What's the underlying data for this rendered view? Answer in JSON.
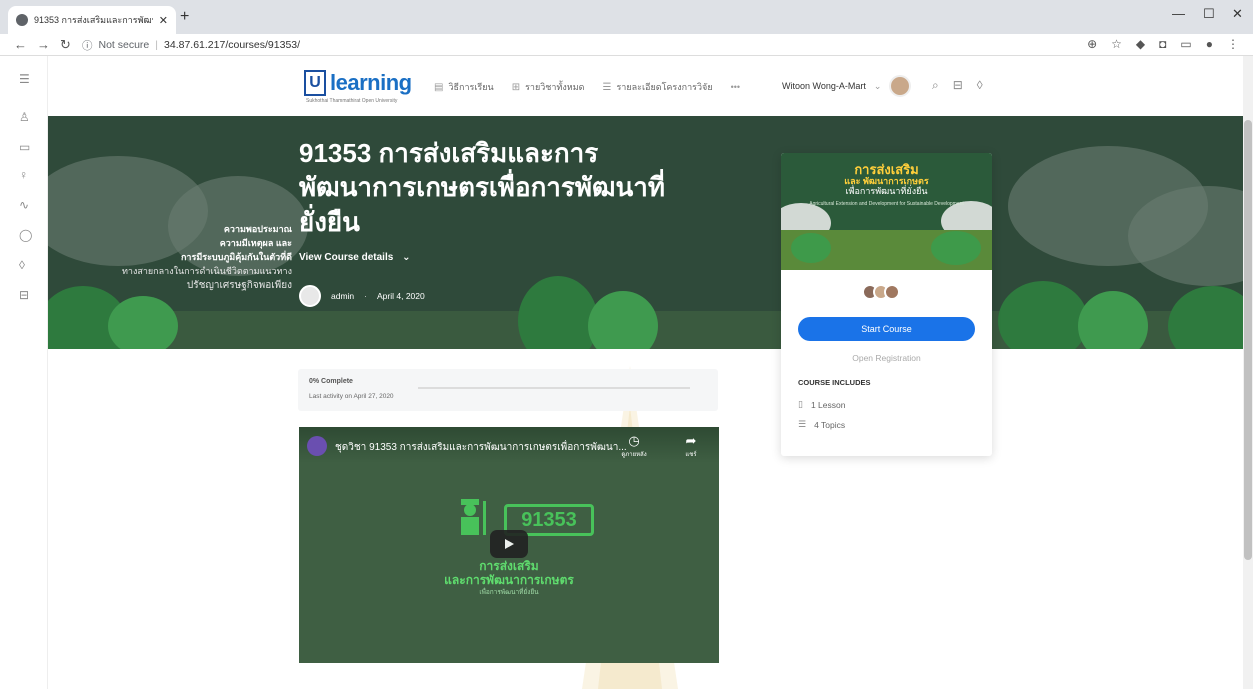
{
  "browser": {
    "tab_title": "91353 การส่งเสริมและการพัฒนาการ",
    "new_tab": "+",
    "url_secure": "Not secure",
    "url": "34.87.61.217/courses/91353/"
  },
  "header": {
    "logo_text": "learning",
    "logo_letter": "U",
    "logo_sub": "Sukhothai Thammathirat Open University",
    "nav": [
      {
        "label": "วิธีการเรียน",
        "icon": "document-icon"
      },
      {
        "label": "รายวิชาทั้งหมด",
        "icon": "grid-icon"
      },
      {
        "label": "รายละเอียดโครงการวิจัย",
        "icon": "list-icon"
      }
    ],
    "more": "•••",
    "user_name": "Witoon Wong-A-Mart",
    "user_chevron": "⌄"
  },
  "hero": {
    "title": "91353 การส่งเสริมและการพัฒนาการเกษตรเพื่อการพัฒนาที่ยั่งยืน",
    "view_details": "View Course details",
    "author": "admin",
    "date": "April 4, 2020",
    "left_text": [
      "ความพอประมาณ",
      "ความมีเหตุผล และ",
      "การมีระบบภูมิคุ้มกันในตัวที่ดี",
      "ทางสายกลางในการดำเนินชีวิตตามแนวทาง",
      "ปรัชญาเศรษฐกิจพอเพียง"
    ]
  },
  "card": {
    "image_title_1": "การส่งเสริม",
    "image_title_2": "และ พัฒนาการเกษตร",
    "image_title_3": "เพื่อการพัฒนาที่ยั่งยืน",
    "image_sub": "Agricultural Extension and Development for Sustainable Development",
    "start_button": "Start Course",
    "open_registration": "Open Registration",
    "includes_title": "COURSE INCLUDES",
    "includes": [
      {
        "label": "1 Lesson",
        "icon": "book-icon"
      },
      {
        "label": "4 Topics",
        "icon": "topics-icon"
      }
    ]
  },
  "progress": {
    "complete": "0% Complete",
    "percent": 0,
    "last_activity": "Last activity on April 27, 2020"
  },
  "video": {
    "title": "ชุดวิชา 91353 การส่งเสริมและการพัฒนาการเกษตรเพื่อการพัฒนา...",
    "watch_later": "ดูภายหลัง",
    "share": "แชร์",
    "code": "91353",
    "line1": "การส่งเสริม",
    "line2": "และการพัฒนาการเกษตร",
    "line3": "เพื่อการพัฒนาที่ยั่งยืน"
  },
  "colors": {
    "accent": "#1a73e8",
    "hero_bg": "#2f4a3a",
    "brand": "#1a6fc4"
  }
}
